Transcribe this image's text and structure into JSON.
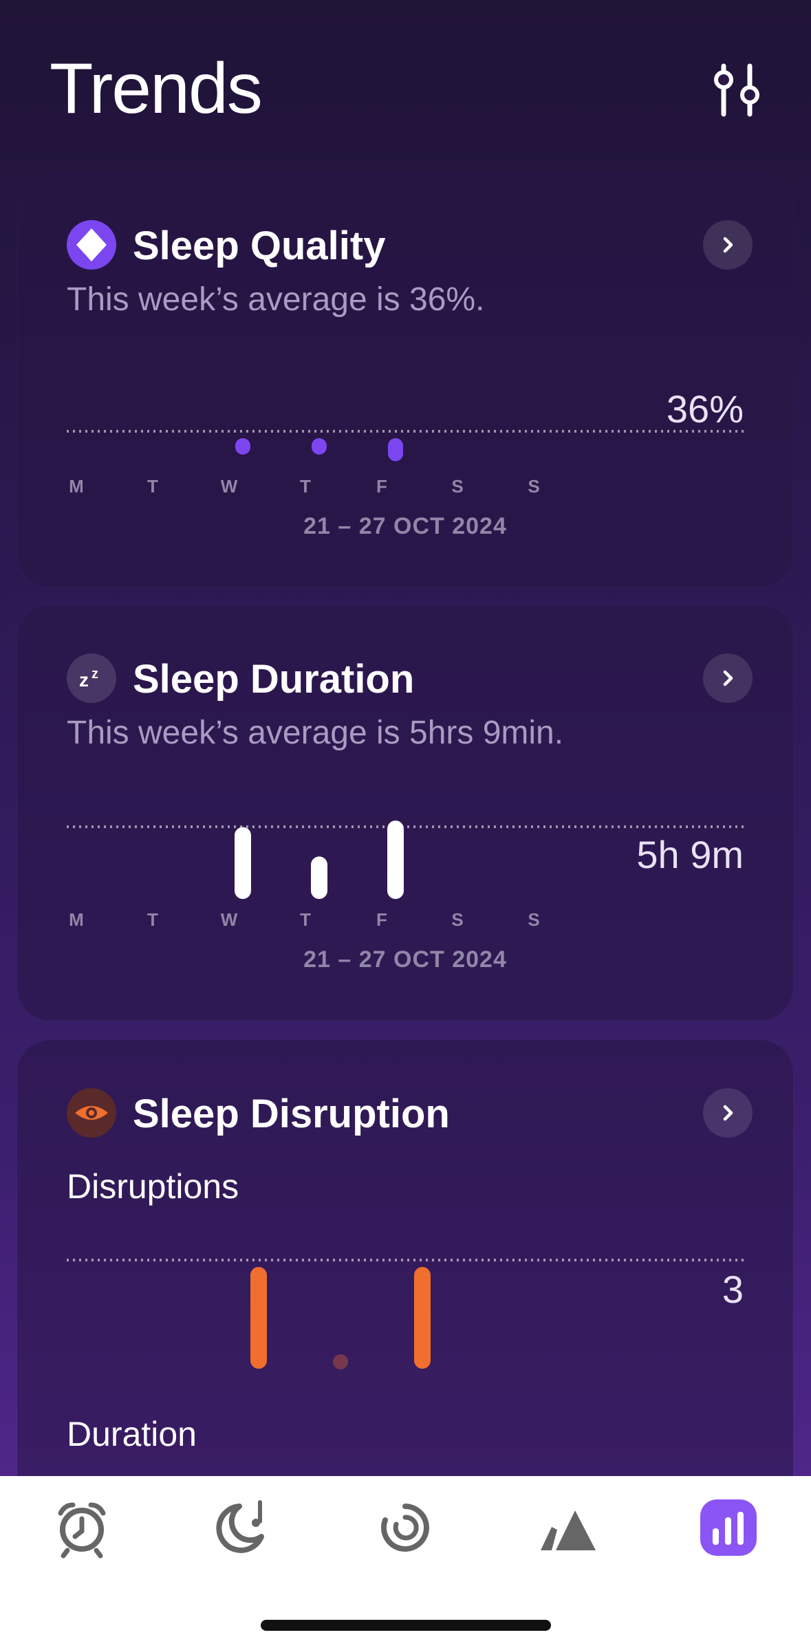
{
  "page": {
    "title": "Trends"
  },
  "colors": {
    "quality_accent": "#7b46f0",
    "disruption_accent": "#f06e2e",
    "duration_bar": "#ffffff",
    "active_tab": "#8b55f5",
    "inactive_tab": "#6b6b6b"
  },
  "days": [
    "M",
    "T",
    "W",
    "T",
    "F",
    "S",
    "S"
  ],
  "quality": {
    "title": "Sleep Quality",
    "subtitle": "This week’s average is 36%.",
    "value_label": "36%",
    "range": "21 – 27 OCT 2024",
    "icon": "diamond-icon"
  },
  "duration": {
    "title": "Sleep Duration",
    "subtitle": "This week’s average is 5hrs 9min.",
    "value_label": "5h 9m",
    "range": "21 – 27 OCT 2024",
    "icon": "zz-icon"
  },
  "disruption": {
    "title": "Sleep Disruption",
    "disruptions_label": "Disruptions",
    "value_label": "3",
    "duration_label": "Duration",
    "icon": "eye-icon"
  },
  "chart_data": [
    {
      "type": "bar",
      "categories": [
        "M",
        "T",
        "W",
        "T",
        "F",
        "S",
        "S"
      ],
      "values": [
        null,
        null,
        20,
        20,
        28,
        null,
        null
      ],
      "title": "Sleep Quality",
      "average_label": "36%"
    },
    {
      "type": "bar",
      "categories": [
        "M",
        "T",
        "W",
        "T",
        "F",
        "S",
        "S"
      ],
      "values": [
        null,
        null,
        5.5,
        3.25,
        6.0,
        null,
        null
      ],
      "title": "Sleep Duration",
      "average_label": "5h 9m"
    },
    {
      "type": "bar",
      "categories": [
        "M",
        "T",
        "W",
        "T",
        "F",
        "S",
        "S"
      ],
      "values": [
        null,
        null,
        3,
        0,
        3,
        null,
        null
      ],
      "title": "Disruptions",
      "average_label": "3"
    }
  ],
  "tabs": [
    {
      "name": "alarm-icon",
      "active": false
    },
    {
      "name": "sleep-sounds-icon",
      "active": false
    },
    {
      "name": "sleep-cycle-icon",
      "active": false
    },
    {
      "name": "mountain-icon",
      "active": false
    },
    {
      "name": "trends-icon",
      "active": true
    }
  ]
}
